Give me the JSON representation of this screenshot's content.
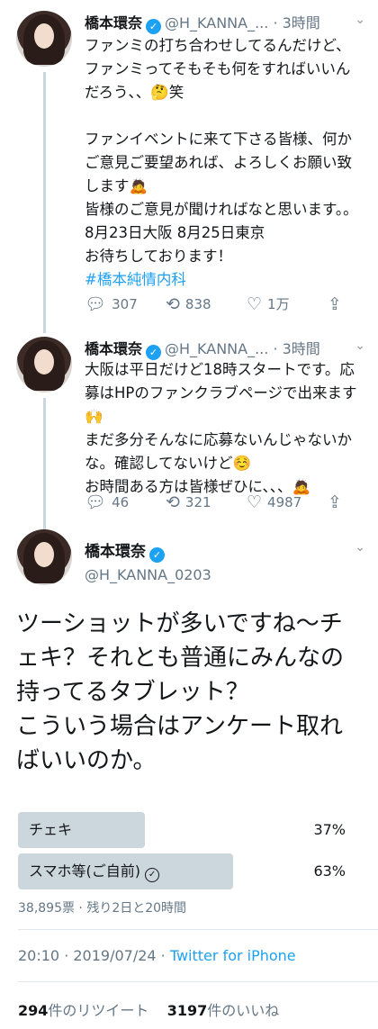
{
  "author": {
    "name": "橋本環奈",
    "handle_short": "@H_KANNA_...",
    "handle_full": "@H_KANNA_0203",
    "verified_icon": "verified-badge"
  },
  "tweets": [
    {
      "time": "· 3時間",
      "text": "ファンミの打ち合わせしてるんだけど、ファンミってそもそも何をすればいいんだろう、、🤔笑\n\nファンイベントに来て下さる皆様、何かご意見ご要望あれば、よろしくお願い致します🙇\n皆様のご意見が聞ければなと思います。。\n8月23日大阪 8月25日東京\nお待ちしております！",
      "hashtag": "#橋本純情内科",
      "replies": "307",
      "retweets": "838",
      "likes": "1万"
    },
    {
      "time": "· 3時間",
      "text": "大阪は平日だけど18時スタートです。応募はHPのファンクラブページで出来ます🙌\nまだ多分そんなに応募ないんじゃないかな。確認してないけど☺️\nお時間ある方は皆様ぜひに、、、🙇",
      "replies": "46",
      "retweets": "321",
      "likes": "4987"
    }
  ],
  "main": {
    "text": "ツーショットが多いですね〜チェキ？それとも普通にみんなの持ってるタブレット？\nこういう場合はアンケート取ればいいのか。",
    "poll": {
      "options": [
        {
          "label": "チェキ",
          "pct": "37%",
          "value": 37
        },
        {
          "label": "スマホ等(ご自前)",
          "pct": "63%",
          "value": 63,
          "selected_icon": "check-circle-icon"
        }
      ],
      "meta": "38,895票 · 残り2日と20時間"
    },
    "timestamp": "20:10 · 2019/07/24 · ",
    "source": "Twitter for iPhone",
    "retweet_count": "294",
    "retweet_label": "件のリツイート",
    "like_count": "3197",
    "like_label": "件のいいね"
  },
  "colors": {
    "accent": "#1da1f2",
    "muted": "#657786",
    "poll_bar": "#ccd6dd"
  }
}
